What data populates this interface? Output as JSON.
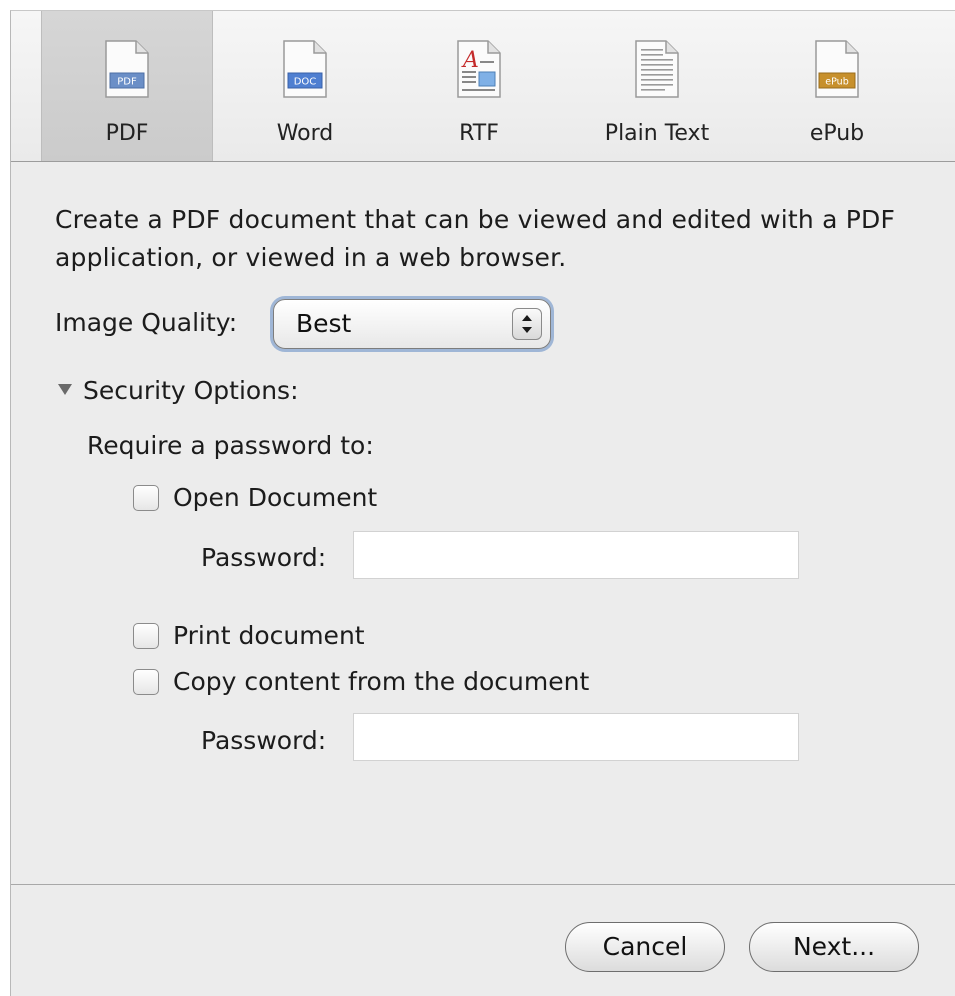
{
  "toolbar": {
    "tabs": [
      {
        "label": "PDF",
        "icon": "pdf-file-icon",
        "badge": "PDF",
        "selected": true
      },
      {
        "label": "Word",
        "icon": "doc-file-icon",
        "badge": "DOC",
        "selected": false
      },
      {
        "label": "RTF",
        "icon": "rtf-file-icon",
        "badge": "A",
        "selected": false
      },
      {
        "label": "Plain Text",
        "icon": "text-file-icon",
        "badge": "",
        "selected": false
      },
      {
        "label": "ePub",
        "icon": "epub-file-icon",
        "badge": "ePub",
        "selected": false
      }
    ]
  },
  "main": {
    "description": "Create a PDF document that can be viewed and edited with a PDF application, or viewed in a web browser.",
    "image_quality": {
      "label": "Image Quality:",
      "value": "Best"
    },
    "security": {
      "label": "Security Options:",
      "expanded": true,
      "require_label": "Require a password to:",
      "open_document": {
        "label": "Open Document",
        "checked": false,
        "password_label": "Password:",
        "password_value": ""
      },
      "print_document": {
        "label": "Print document",
        "checked": false
      },
      "copy_content": {
        "label": "Copy content from the document",
        "checked": false,
        "password_label": "Password:",
        "password_value": ""
      }
    }
  },
  "footer": {
    "cancel_label": "Cancel",
    "next_label": "Next..."
  },
  "colors": {
    "panel": "#ececec",
    "focus_ring": "#9fb6d6",
    "pdf_badge": "#6b8fc7",
    "doc_badge": "#4f7fd1",
    "epub_badge": "#c7902c"
  }
}
